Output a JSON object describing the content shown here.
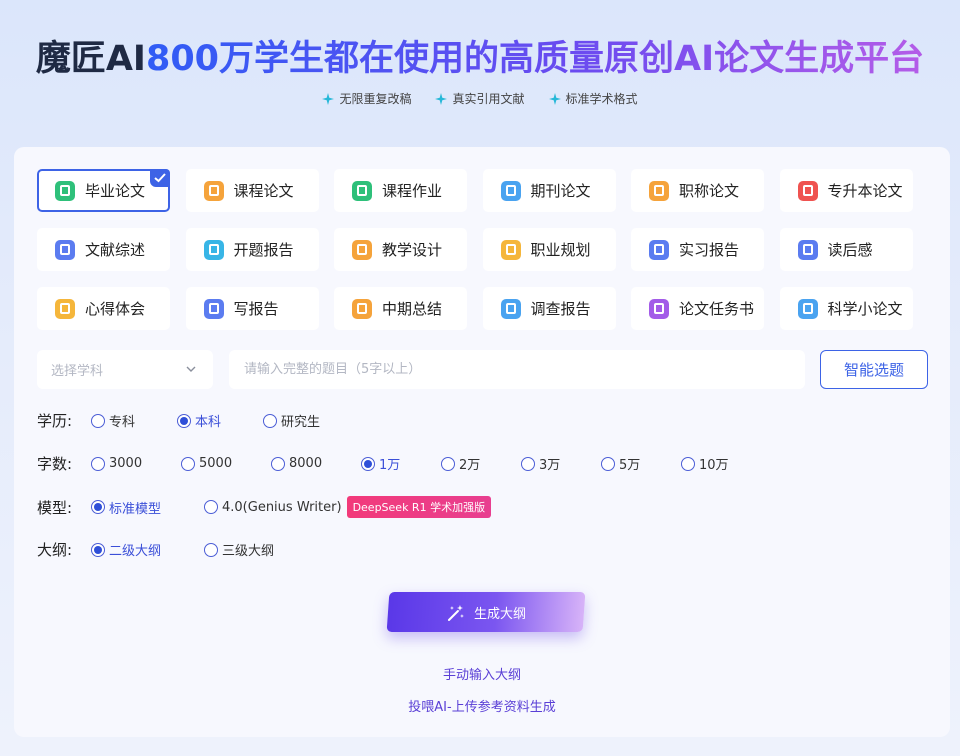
{
  "header": {
    "title_prefix": "魔匠AI",
    "title_highlight": "800万学生都在使用的高质量原创AI论文生成平台",
    "features": [
      "无限重复改稿",
      "真实引用文献",
      "标准学术格式"
    ]
  },
  "paper_types": [
    {
      "label": "毕业论文",
      "color": "#2ec07a",
      "selected": true,
      "icon": "doc-icon"
    },
    {
      "label": "课程论文",
      "color": "#f5a33b",
      "selected": false,
      "icon": "book-icon"
    },
    {
      "label": "课程作业",
      "color": "#2ec07a",
      "selected": false,
      "icon": "list-icon"
    },
    {
      "label": "期刊论文",
      "color": "#4aa3f0",
      "selected": false,
      "icon": "journal-icon"
    },
    {
      "label": "职称论文",
      "color": "#f5a33b",
      "selected": false,
      "icon": "medal-icon"
    },
    {
      "label": "专升本论文",
      "color": "#ef5350",
      "selected": false,
      "icon": "cap-icon"
    },
    {
      "label": "文献综述",
      "color": "#5b7cf0",
      "selected": false,
      "icon": "text-icon"
    },
    {
      "label": "开题报告",
      "color": "#38b5e6",
      "selected": false,
      "icon": "report-icon"
    },
    {
      "label": "教学设计",
      "color": "#f5a33b",
      "selected": false,
      "icon": "person-icon"
    },
    {
      "label": "职业规划",
      "color": "#f5b63b",
      "selected": false,
      "icon": "book-icon"
    },
    {
      "label": "实习报告",
      "color": "#5b7cf0",
      "selected": false,
      "icon": "text-icon"
    },
    {
      "label": "读后感",
      "color": "#5b7cf0",
      "selected": false,
      "icon": "text-icon"
    },
    {
      "label": "心得体会",
      "color": "#f5b63b",
      "selected": false,
      "icon": "book-icon"
    },
    {
      "label": "写报告",
      "color": "#5b7cf0",
      "selected": false,
      "icon": "text-icon"
    },
    {
      "label": "中期总结",
      "color": "#f5a33b",
      "selected": false,
      "icon": "book-icon"
    },
    {
      "label": "调查报告",
      "color": "#4aa3f0",
      "selected": false,
      "icon": "survey-icon"
    },
    {
      "label": "论文任务书",
      "color": "#a35ce8",
      "selected": false,
      "icon": "task-icon"
    },
    {
      "label": "科学小论文",
      "color": "#4aa3f0",
      "selected": false,
      "icon": "science-icon"
    }
  ],
  "subject": {
    "placeholder": "选择学科"
  },
  "topic": {
    "placeholder": "请输入完整的题目（5字以上）",
    "value": ""
  },
  "smart_button": "智能选题",
  "options": {
    "education": {
      "label": "学历:",
      "choices": [
        "专科",
        "本科",
        "研究生"
      ],
      "selected": "本科"
    },
    "words": {
      "label": "字数:",
      "choices": [
        "3000",
        "5000",
        "8000",
        "1万",
        "2万",
        "3万",
        "5万",
        "10万"
      ],
      "selected": "1万"
    },
    "model": {
      "label": "模型:",
      "choices": [
        "标准模型",
        "4.0(Genius Writer)"
      ],
      "selected": "标准模型",
      "badge": "DeepSeek R1 学术加强版"
    },
    "outline": {
      "label": "大纲:",
      "choices": [
        "二级大纲",
        "三级大纲"
      ],
      "selected": "二级大纲"
    }
  },
  "generate_button": "生成大纲",
  "links": {
    "manual": "手动输入大纲",
    "upload": "投喂AI-上传参考资料生成"
  },
  "colors": {
    "accent": "#3d63e6",
    "purple": "#5a3fd6",
    "badge": "#e83f90"
  }
}
